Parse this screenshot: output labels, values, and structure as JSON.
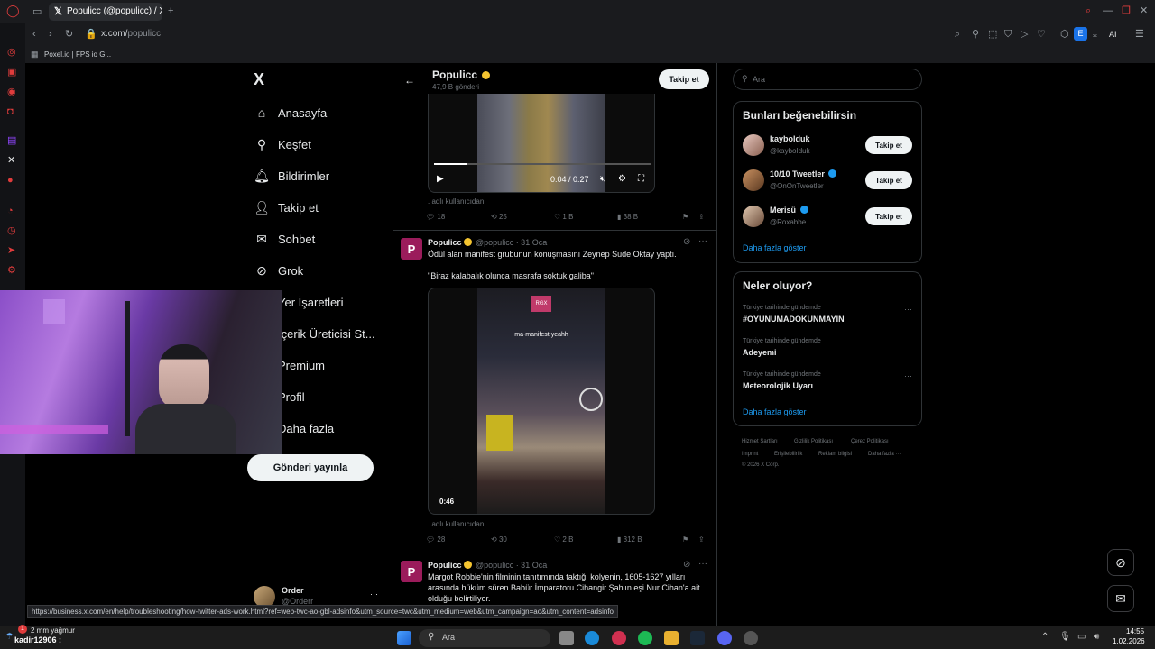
{
  "browser": {
    "tab_title": "Populicc (@populicc) / X",
    "url_host": "x.com/",
    "url_path": "populicc",
    "bookmark": "Poxel.io | FPS io G...",
    "new_tab": "+",
    "ai_label": "AI",
    "ext_label": "E"
  },
  "nav": {
    "logo": "X",
    "items": [
      {
        "label": "Anasayfa",
        "icon": "home-icon"
      },
      {
        "label": "Keşfet",
        "icon": "search-icon"
      },
      {
        "label": "Bildirimler",
        "icon": "bell-icon"
      },
      {
        "label": "Takip et",
        "icon": "follow-icon"
      },
      {
        "label": "Sohbet",
        "icon": "mail-icon"
      },
      {
        "label": "Grok",
        "icon": "grok-icon"
      },
      {
        "label": "Yer İşaretleri",
        "icon": "bookmark-icon"
      },
      {
        "label": "İçerik Üreticisi St...",
        "icon": "creator-icon"
      },
      {
        "label": "Premium",
        "icon": "premium-icon"
      },
      {
        "label": "Profil",
        "icon": "profile-icon"
      },
      {
        "label": "Daha fazla",
        "icon": "more-icon"
      }
    ],
    "post_button": "Gönderi yayınla",
    "account_name": "Order",
    "account_handle": "@Orderr",
    "account_more": "···"
  },
  "profile_header": {
    "name": "Populicc",
    "posts": "47,9 B gönderi",
    "follow": "Takip et"
  },
  "tweets": [
    {
      "video_time": "0:04 / 0:27",
      "source": ". adlı kullanıcıdan",
      "replies": "18",
      "reposts": "25",
      "likes": "1 B",
      "views": "38 B"
    },
    {
      "name": "Populicc",
      "handle": "@populicc · 31 Oca",
      "text1": "Ödül alan manifest grubunun konuşmasını Zeynep Sude Oktay yaptı.",
      "text2": "\"Biraz kalabalık olunca masrafa soktuk galiba\"",
      "video_caption": "ma-manifest yeahh",
      "video_badge": "RGX",
      "video_duration": "0:46",
      "source": ". adlı kullanıcıdan",
      "replies": "28",
      "reposts": "30",
      "likes": "2 B",
      "views": "312 B"
    },
    {
      "name": "Populicc",
      "handle": "@populicc · 31 Oca",
      "text1": "Margot Robbie'nin filminin tanıtımında taktığı kolyenin, 1605-1627 yılları",
      "text2": "arasında hüküm süren Babür İmparatoru Cihangir Şah'ın eşi Nur Cihan'a ait",
      "text3": "olduğu belirtiliyor."
    }
  ],
  "search": {
    "placeholder": "Ara"
  },
  "who_to_follow": {
    "title": "Bunları beğenebilirsin",
    "users": [
      {
        "name": "kaybolduk",
        "handle": "@kayboIduk",
        "verified": false
      },
      {
        "name": "10/10 Tweetler",
        "handle": "@OnOnTweetler",
        "verified": true
      },
      {
        "name": "Merisü",
        "handle": "@Roxabbe",
        "verified": true
      }
    ],
    "follow": "Takip et",
    "show_more": "Daha fazla göster"
  },
  "trends": {
    "title": "Neler oluyor?",
    "items": [
      {
        "context": "Türkiye tarihinde gündemde",
        "name": "#OYUNUMADOKUNMAYIN"
      },
      {
        "context": "Türkiye tarihinde gündemde",
        "name": "Adeyemi"
      },
      {
        "context": "Türkiye tarihinde gündemde",
        "name": "Meteorolojik Uyarı"
      }
    ],
    "more": "···",
    "show_more": "Daha fazla göster"
  },
  "footer": {
    "links": [
      "Hizmet Şartları",
      "Gizlilik Politikası",
      "Çerez Politikası",
      "Imprint",
      "Erişilebilirlik",
      "Reklam bilgisi",
      "Daha fazla ···"
    ],
    "copyright": "© 2026 X Corp."
  },
  "status_url": "https://business.x.com/en/help/troubleshooting/how-twitter-ads-work.html?ref=web-twc-ao-gbl-adsinfo&utm_source=twc&utm_medium=web&utm_campaign=ao&utm_content=adsinfo",
  "taskbar": {
    "weather": "2 mm yağmur",
    "chat_user": "kadir12906 :",
    "search": "Ara",
    "time": "14:55",
    "date": "1.02.2026",
    "badge": "1"
  },
  "colors": {
    "accent": "#1d9bf0",
    "verified_gold": "#f4c430",
    "background": "#000000"
  }
}
